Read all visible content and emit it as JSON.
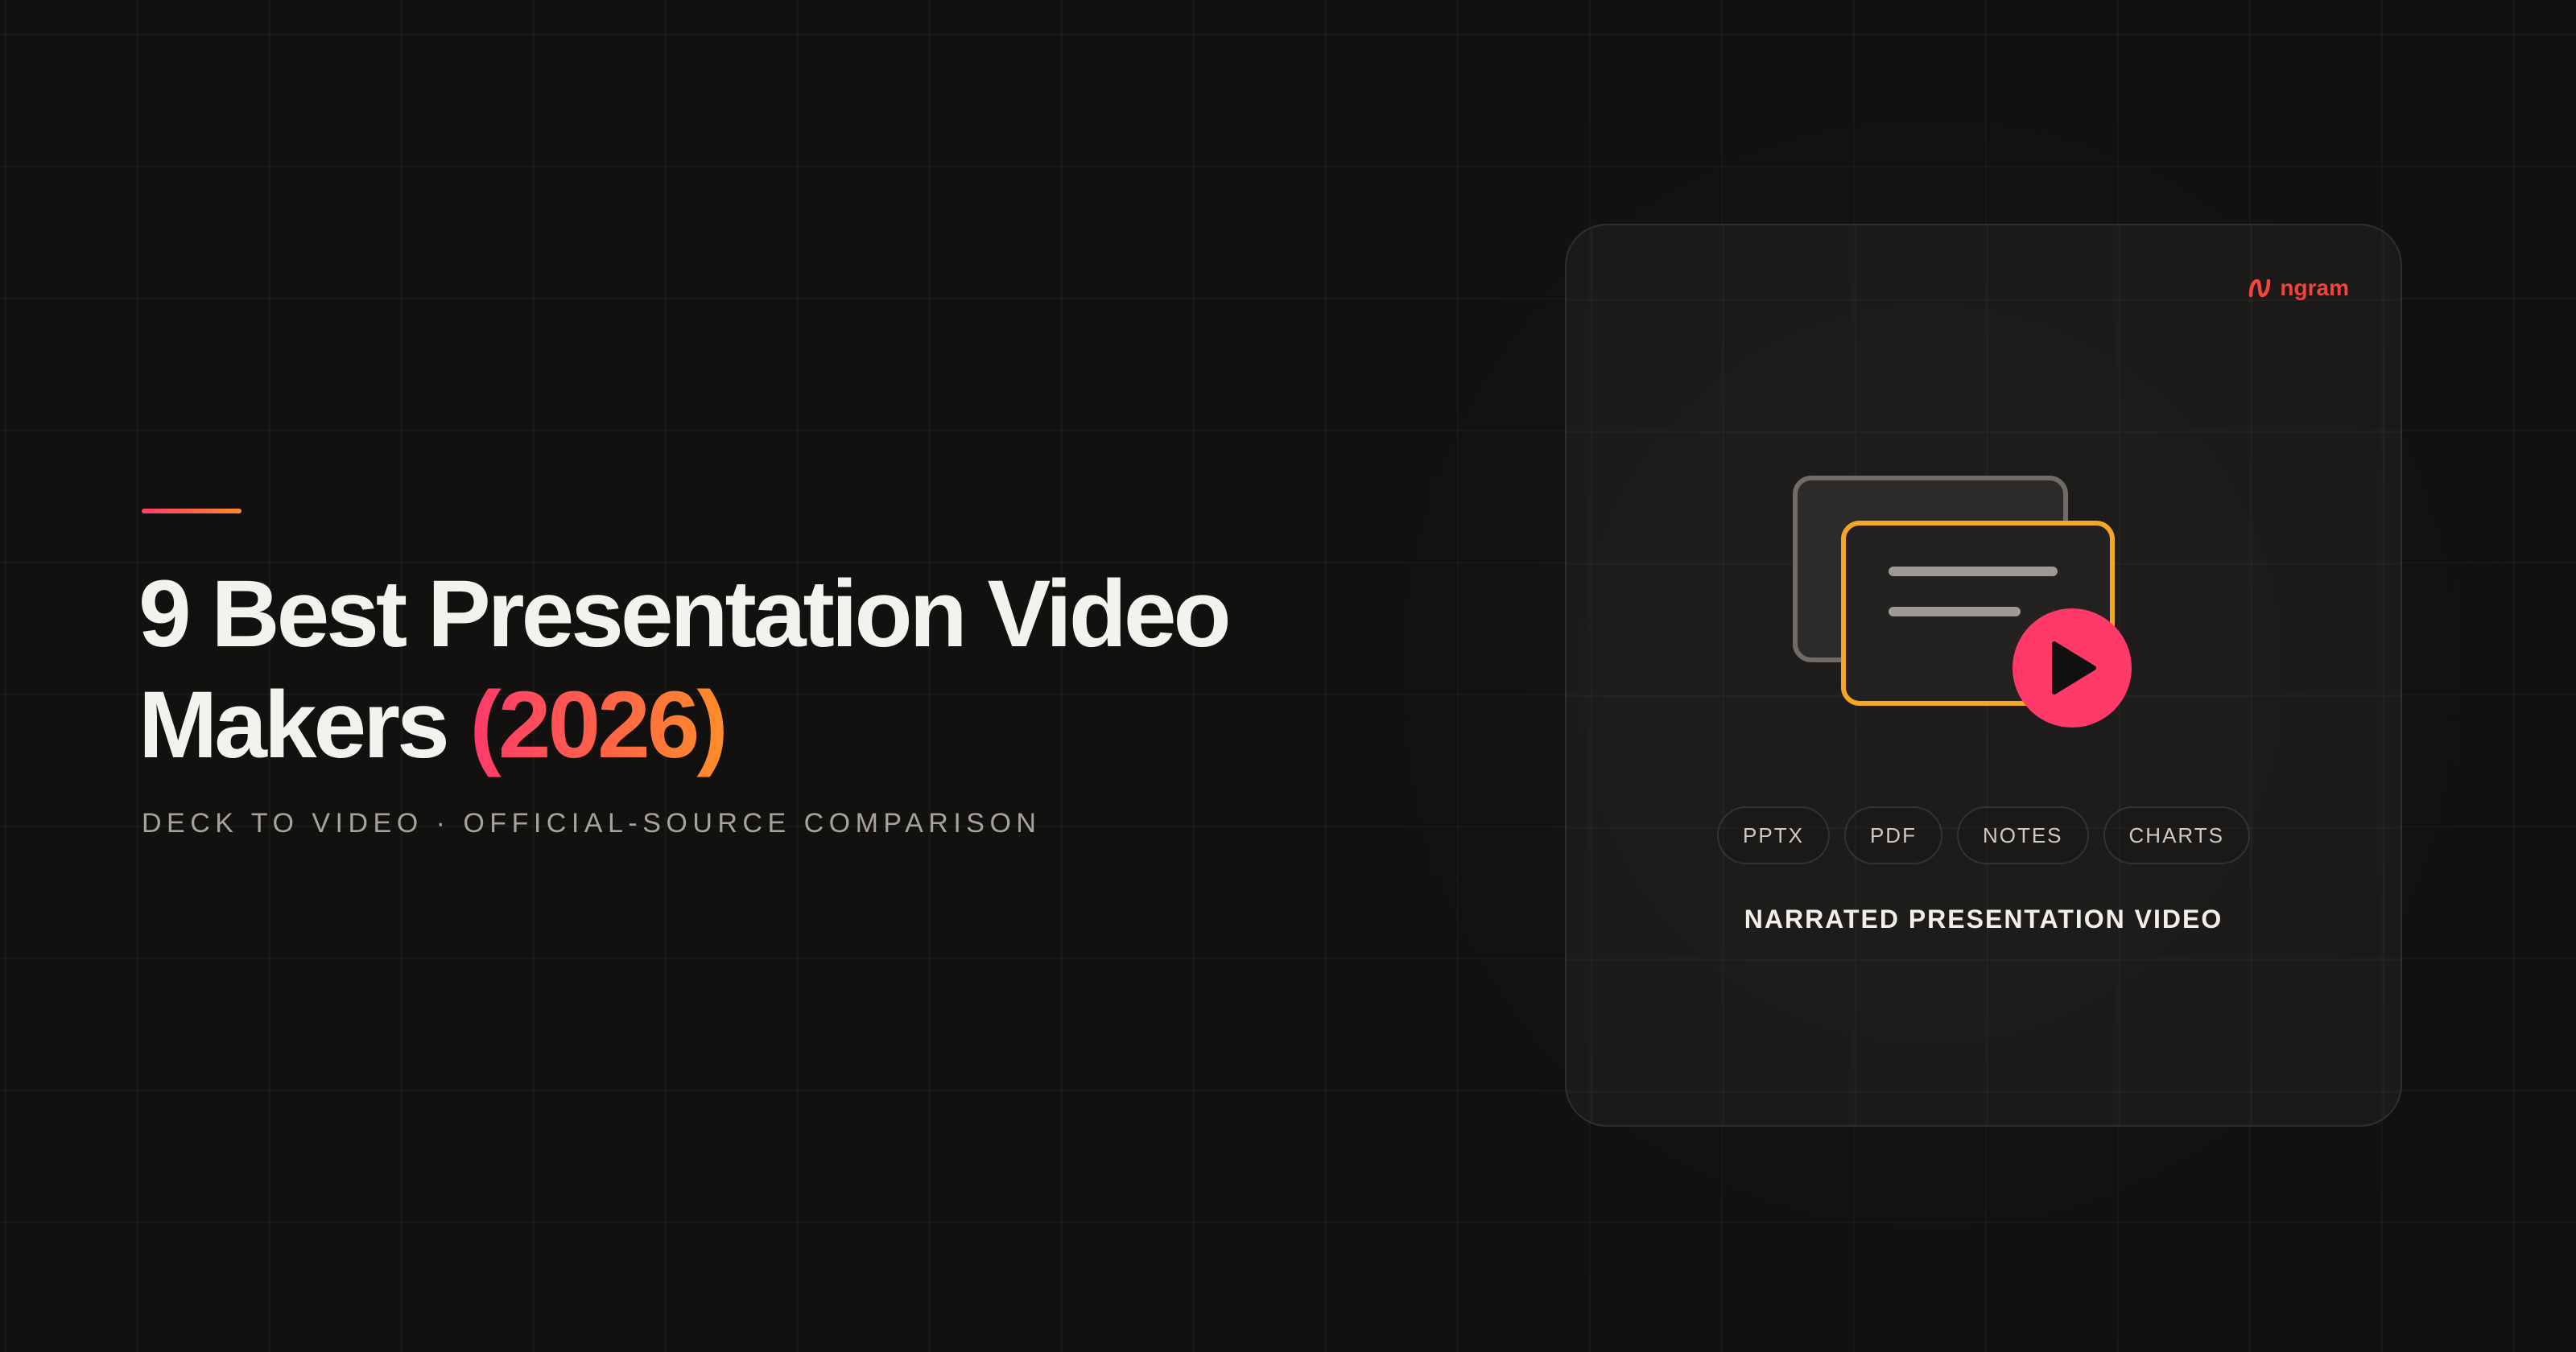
{
  "headline": {
    "line1": "9 Best Presentation Video",
    "line2_main": "Makers",
    "line2_year": "(2026)"
  },
  "subtitle": "DECK TO VIDEO · OFFICIAL-SOURCE COMPARISON",
  "card": {
    "brand": "ngram",
    "chips": [
      "PPTX",
      "PDF",
      "NOTES",
      "CHARTS"
    ],
    "caption": "NARRATED PRESENTATION VIDEO"
  },
  "colors": {
    "background": "#12110f",
    "accent_pink": "#ff3a6c",
    "accent_orange": "#ff8d28",
    "play_button": "#ff3a68",
    "front_slide_border": "#f5a623",
    "brand": "#f0443c"
  },
  "icons": [
    "ngram-logo-icon",
    "back-slide-icon",
    "front-slide-icon",
    "play-icon"
  ]
}
